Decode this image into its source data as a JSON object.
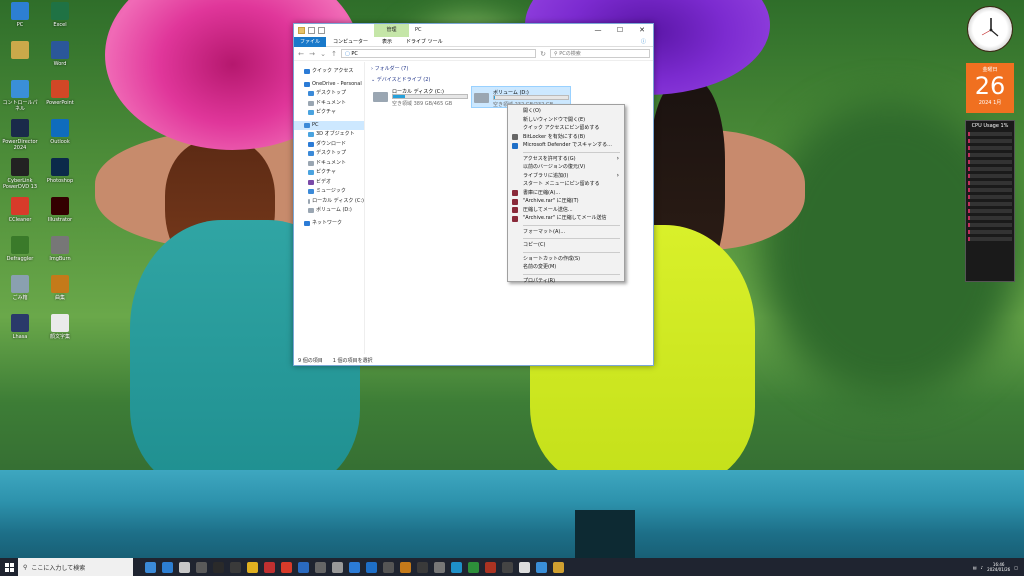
{
  "desktop": {
    "icons": [
      {
        "label": "PC",
        "color": "#2d7fd3"
      },
      {
        "label": "Excel",
        "color": "#1f7244"
      },
      {
        "label": "",
        "color": "#caa94a"
      },
      {
        "label": "Word",
        "color": "#2b579a"
      },
      {
        "label": "コントロールパネル",
        "color": "#3a8fd8"
      },
      {
        "label": "PowerPoint",
        "color": "#d24726"
      },
      {
        "label": "PowerDirector 2024",
        "color": "#1a2a4a"
      },
      {
        "label": "Outlook",
        "color": "#0f6cbd"
      },
      {
        "label": "CyberLink PowerDVD 13",
        "color": "#222"
      },
      {
        "label": "Photoshop",
        "color": "#0b2a4a"
      },
      {
        "label": "CCleaner",
        "color": "#d83b2a"
      },
      {
        "label": "Illustrator",
        "color": "#330000"
      },
      {
        "label": "Defraggler",
        "color": "#3a7a2a"
      },
      {
        "label": "ImgBurn",
        "color": "#777"
      },
      {
        "label": "ごみ箱",
        "color": "#8aa0b0"
      },
      {
        "label": "曲集",
        "color": "#c47a1a"
      },
      {
        "label": "Lhasa",
        "color": "#2a3a6a"
      },
      {
        "label": "顔文字集",
        "color": "#eaeaea"
      }
    ]
  },
  "gadgets": {
    "calendar": {
      "dow": "金曜日",
      "day": "26",
      "ym": "2024 1月"
    },
    "cpu": {
      "title": "CPU Usage",
      "pct": "1%",
      "level": 0.01
    }
  },
  "explorer": {
    "manage_tab": "管理",
    "title": "PC",
    "tabs": [
      "ファイル",
      "コンピューター",
      "表示",
      "ドライブ ツール"
    ],
    "address": "PC",
    "search_placeholder": "PCの検索",
    "nav": [
      {
        "label": "クイック アクセス",
        "color": "#2b7bd6",
        "sub": false,
        "sel": false
      },
      {
        "label": "OneDrive - Personal",
        "color": "#2b7bd6",
        "sub": false,
        "sel": false
      },
      {
        "label": "デスクトップ",
        "color": "#3b8ad8",
        "sub": true,
        "sel": false
      },
      {
        "label": "ドキュメント",
        "color": "#9aa6b2",
        "sub": true,
        "sel": false
      },
      {
        "label": "ピクチャ",
        "color": "#4aa3df",
        "sub": true,
        "sel": false
      },
      {
        "label": "PC",
        "color": "#3b8ad8",
        "sub": false,
        "sel": true
      },
      {
        "label": "3D オブジェクト",
        "color": "#4aa3df",
        "sub": true,
        "sel": false
      },
      {
        "label": "ダウンロード",
        "color": "#2b7bd6",
        "sub": true,
        "sel": false
      },
      {
        "label": "デスクトップ",
        "color": "#3b8ad8",
        "sub": true,
        "sel": false
      },
      {
        "label": "ドキュメント",
        "color": "#9aa6b2",
        "sub": true,
        "sel": false
      },
      {
        "label": "ピクチャ",
        "color": "#4aa3df",
        "sub": true,
        "sel": false
      },
      {
        "label": "ビデオ",
        "color": "#7a4aa8",
        "sub": true,
        "sel": false
      },
      {
        "label": "ミュージック",
        "color": "#3b8ad8",
        "sub": true,
        "sel": false
      },
      {
        "label": "ローカル ディスク (C:)",
        "color": "#9aa6b2",
        "sub": true,
        "sel": false
      },
      {
        "label": "ボリューム (D:)",
        "color": "#9aa6b2",
        "sub": true,
        "sel": false
      },
      {
        "label": "ネットワーク",
        "color": "#2b7bd6",
        "sub": false,
        "sel": false
      }
    ],
    "groups": {
      "folders": "フォルダー (7)",
      "drives": "デバイスとドライブ (2)"
    },
    "drives": [
      {
        "name": "ローカル ディスク (C:)",
        "free": "空き領域 389 GB/465 GB",
        "used": 0.16,
        "sel": false
      },
      {
        "name": "ボリューム (D:)",
        "free": "空き領域 232 GB/232 GB",
        "used": 0.01,
        "sel": true
      }
    ],
    "status": {
      "items": "9 個の項目",
      "selected": "1 個の項目を選択"
    }
  },
  "context_menu": {
    "items": [
      {
        "label": "開く(O)",
        "icon": "",
        "sub": false
      },
      {
        "label": "新しいウィンドウで開く(E)",
        "icon": "",
        "sub": false
      },
      {
        "label": "クイック アクセスにピン留めする",
        "icon": "",
        "sub": false
      },
      {
        "label": "BitLocker を有効にする(B)",
        "icon": "#666",
        "sub": false
      },
      {
        "label": "Microsoft Defender でスキャンする...",
        "icon": "#1e6fc8",
        "sub": false
      },
      {
        "sep": true
      },
      {
        "label": "アクセスを許可する(G)",
        "icon": "",
        "sub": true
      },
      {
        "label": "以前のバージョンの復元(V)",
        "icon": "",
        "sub": false
      },
      {
        "label": "ライブラリに追加(I)",
        "icon": "",
        "sub": true
      },
      {
        "label": "スタート メニューにピン留めする",
        "icon": "",
        "sub": false
      },
      {
        "label": "書庫に圧縮(A)...",
        "icon": "#8a2a3a",
        "sub": false
      },
      {
        "label": "\"Archive.rar\" に圧縮(T)",
        "icon": "#8a2a3a",
        "sub": false
      },
      {
        "label": "圧縮してメール送信...",
        "icon": "#8a2a3a",
        "sub": false
      },
      {
        "label": "\"Archive.rar\" に圧縮してメール送信",
        "icon": "#8a2a3a",
        "sub": false
      },
      {
        "sep": true
      },
      {
        "label": "フォーマット(A)...",
        "icon": "",
        "sub": false
      },
      {
        "sep": true
      },
      {
        "label": "コピー(C)",
        "icon": "",
        "sub": false
      },
      {
        "sep": true
      },
      {
        "label": "ショートカットの作成(S)",
        "icon": "",
        "sub": false
      },
      {
        "label": "名前の変更(M)",
        "icon": "",
        "sub": false
      },
      {
        "sep": true
      },
      {
        "label": "プロパティ(R)",
        "icon": "",
        "sub": false
      }
    ]
  },
  "taskbar": {
    "search_placeholder": "ここに入力して検索",
    "icon_colors": [
      "#3b8ad8",
      "#2d7fd3",
      "#c8c8c8",
      "#5a5a5a",
      "#2a2a2a",
      "#3a3a3a",
      "#e0b020",
      "#c03030",
      "#d83b2a",
      "#2a6ac0",
      "#666",
      "#999",
      "#2b7bd6",
      "#1e6fc8",
      "#555",
      "#c47a1a",
      "#3a3a3a",
      "#777",
      "#1e90c8",
      "#2d8f3a",
      "#aa3322",
      "#444",
      "#ddd",
      "#3a8fd8",
      "#d0a030"
    ],
    "time": "16:46",
    "date": "2024/01/26"
  }
}
